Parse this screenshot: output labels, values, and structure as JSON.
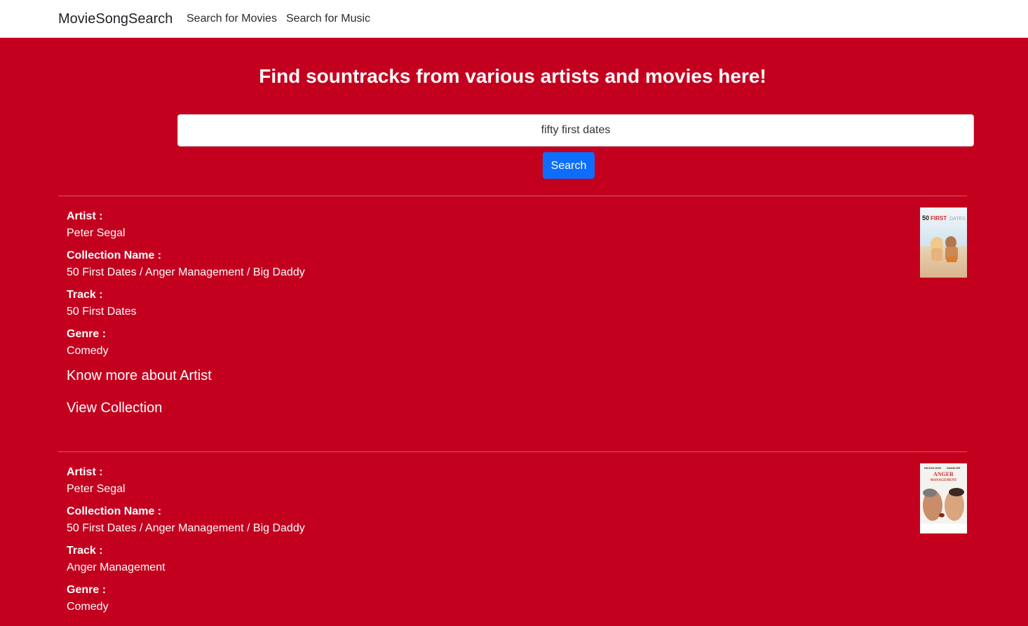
{
  "navbar": {
    "brand": "MovieSongSearch",
    "links": [
      "Search for Movies",
      "Search for Music"
    ]
  },
  "hero": {
    "title": "Find sountracks from various artists and movies here!"
  },
  "search": {
    "value": "fifty first dates",
    "button_label": "Search"
  },
  "labels": {
    "artist": "Artist :",
    "collection": "Collection Name :",
    "track": "Track :",
    "genre": "Genre :"
  },
  "results": [
    {
      "artist": "Peter Segal",
      "collection": "50 First Dates / Anger Management / Big Daddy",
      "track": "50 First Dates",
      "genre": "Comedy",
      "link_artist": "Know more about Artist",
      "link_collection": "View Collection",
      "poster_text": "50FIRSTDATES"
    },
    {
      "artist": "Peter Segal",
      "collection": "50 First Dates / Anger Management / Big Daddy",
      "track": "Anger Management",
      "genre": "Comedy",
      "poster_text": "NICHOLSON SANDLER ANGER MANAGEMENT"
    }
  ],
  "colors": {
    "background": "#c4001f",
    "button": "#0d6efd"
  }
}
